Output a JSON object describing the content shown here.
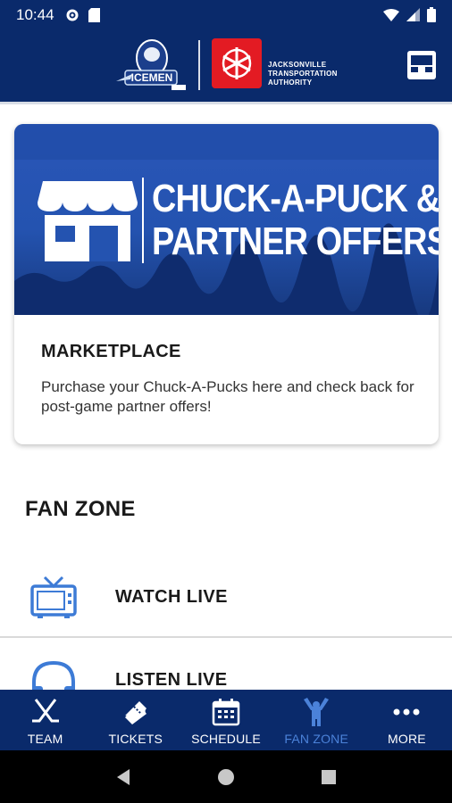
{
  "status_bar": {
    "time": "10:44"
  },
  "header": {
    "team_logo_text": "ICEMEN",
    "partner_name_lines": [
      "JACKSONVILLE",
      "TRANSPORTATION",
      "AUTHORITY"
    ]
  },
  "marketplace_card": {
    "banner_lines": [
      "CHUCK-A-PUCK &",
      "PARTNER OFFERS"
    ],
    "title": "MARKETPLACE",
    "description": "Purchase your Chuck-A-Pucks here and check back for post-game partner offers!"
  },
  "fan_zone": {
    "title": "FAN ZONE",
    "items": [
      {
        "label": "WATCH LIVE",
        "icon": "tv-icon"
      },
      {
        "label": "LISTEN LIVE",
        "icon": "headphones-icon"
      }
    ]
  },
  "tab_bar": {
    "tabs": [
      {
        "label": "TEAM",
        "icon": "hockey-sticks-icon"
      },
      {
        "label": "TICKETS",
        "icon": "ticket-icon"
      },
      {
        "label": "SCHEDULE",
        "icon": "calendar-icon"
      },
      {
        "label": "FAN ZONE",
        "icon": "fan-icon",
        "active": true
      },
      {
        "label": "MORE",
        "icon": "more-dots-icon"
      }
    ]
  },
  "colors": {
    "brand_navy": "#0a2a6b",
    "accent_blue": "#4b82d9",
    "jta_red": "#e31b23",
    "banner_blue": "#2453b0"
  }
}
